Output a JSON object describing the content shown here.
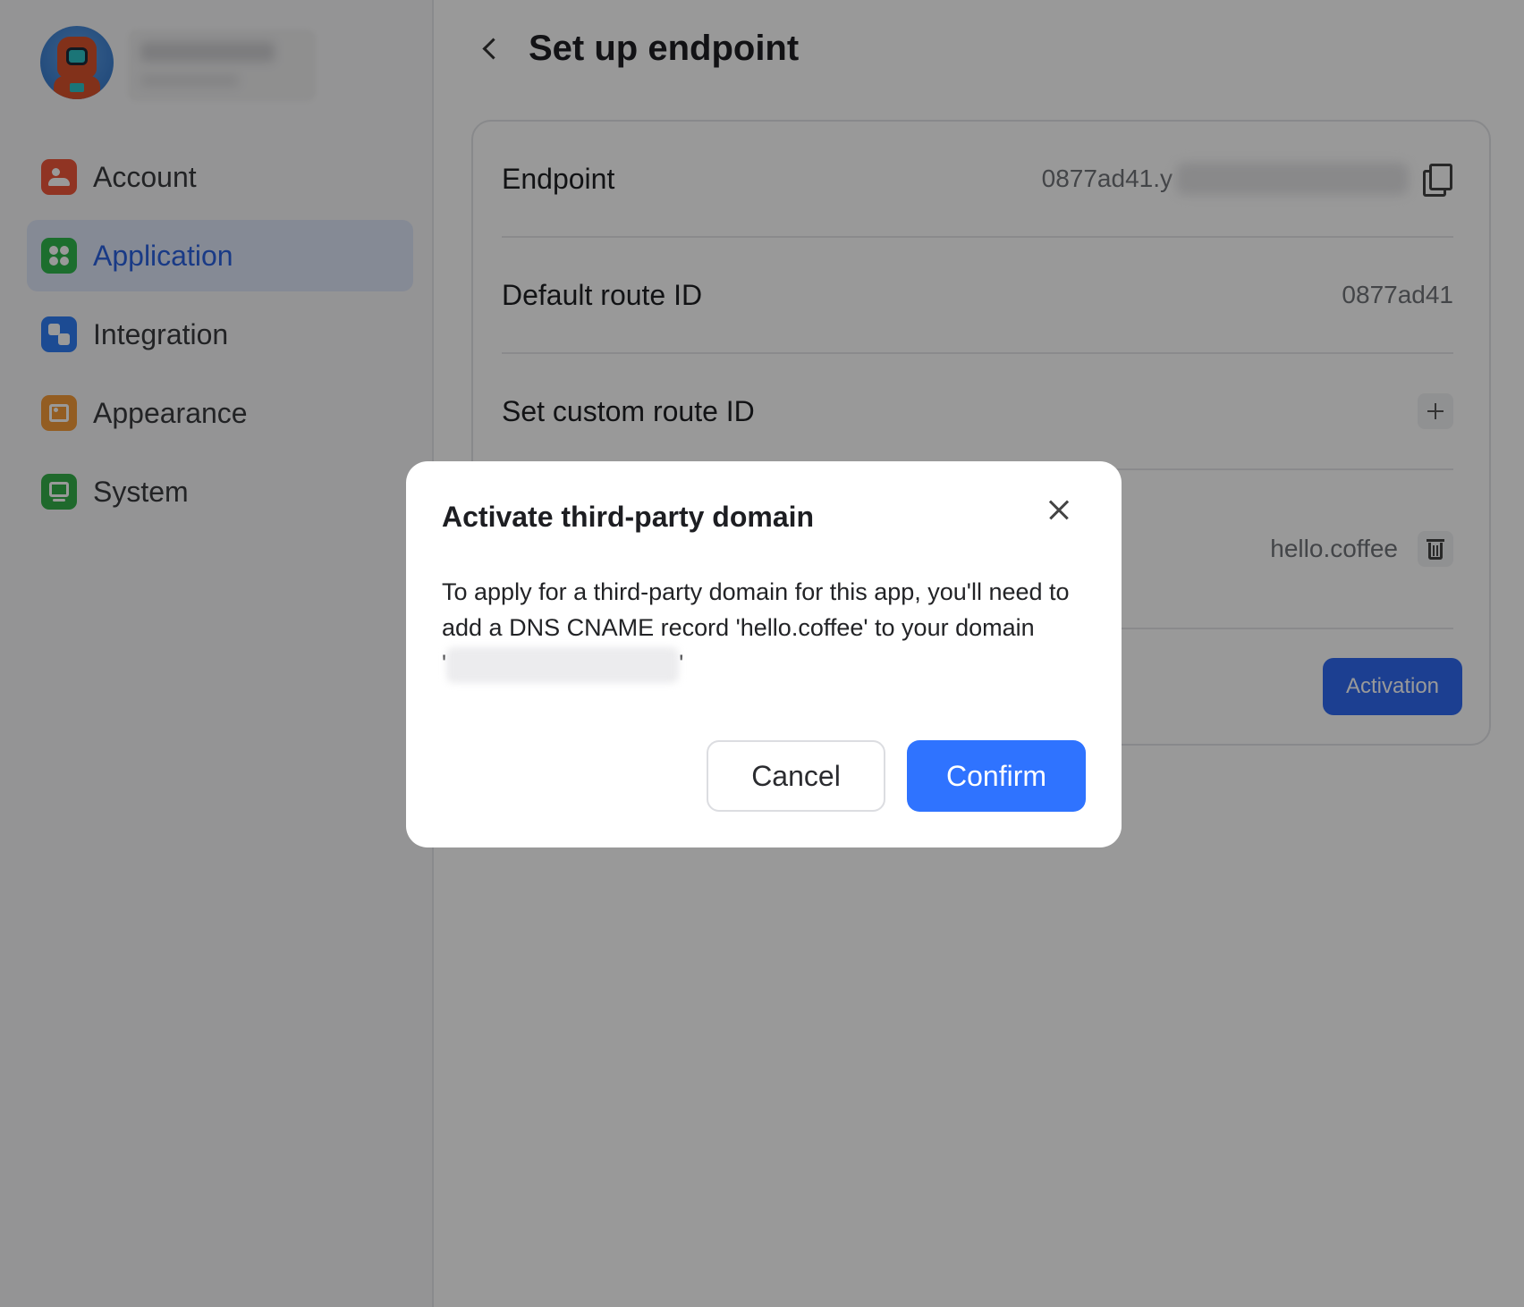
{
  "sidebar": {
    "items": [
      {
        "label": "Account",
        "icon": "account-icon",
        "active": false
      },
      {
        "label": "Application",
        "icon": "application-icon",
        "active": true
      },
      {
        "label": "Integration",
        "icon": "integration-icon",
        "active": false
      },
      {
        "label": "Appearance",
        "icon": "appearance-icon",
        "active": false
      },
      {
        "label": "System",
        "icon": "system-icon",
        "active": false
      }
    ]
  },
  "header": {
    "title": "Set up endpoint"
  },
  "settings": {
    "endpoint": {
      "label": "Endpoint",
      "value": "0877ad41.y"
    },
    "default_route": {
      "label": "Default route ID",
      "value": "0877ad41"
    },
    "custom_route": {
      "label": "Set custom route ID"
    },
    "third_party_domain": {
      "value": "hello.coffee"
    },
    "activation_label": "Activation"
  },
  "modal": {
    "title": "Activate third-party domain",
    "body": "To apply for a third-party domain for this app, you'll need to add a DNS CNAME record 'hello.coffee' to your domain",
    "quote_open": "'",
    "quote_close": "'",
    "cancel_label": "Cancel",
    "confirm_label": "Confirm"
  },
  "colors": {
    "accent": "#2f73ff",
    "active_nav_bg": "#dee6f8",
    "active_nav_text": "#2b62e0"
  }
}
